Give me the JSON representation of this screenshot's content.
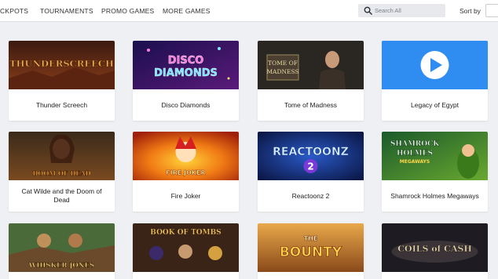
{
  "nav": {
    "items": [
      "CKPOTS",
      "TOURNAMENTS",
      "PROMO GAMES",
      "MORE GAMES"
    ]
  },
  "search": {
    "placeholder": "Search All",
    "icon": "search-icon"
  },
  "sort": {
    "label": "Sort by"
  },
  "games": [
    {
      "title": "Thunder Screech",
      "art_text": "THUNDERSCREECH"
    },
    {
      "title": "Disco Diamonds",
      "art_text_1": "DISCO",
      "art_text_2": "DIAMONDS"
    },
    {
      "title": "Tome of Madness",
      "art_text_1": "TOME OF",
      "art_text_2": "MADNESS"
    },
    {
      "title": "Legacy of Egypt",
      "icon": "play-icon"
    },
    {
      "title": "Cat Wilde and the Doom of Dead",
      "art_text": "DOOM OF DEAD"
    },
    {
      "title": "Fire Joker",
      "art_text": "FIRE JOKER"
    },
    {
      "title": "Reactoonz 2",
      "art_text": "REACTOONZ"
    },
    {
      "title": "Shamrock Holmes Megaways",
      "art_text_1": "SHAMROCK",
      "art_text_2": "HOLMES",
      "art_text_3": "MEGAWAYS"
    },
    {
      "title": "",
      "art_text": "WHISKER JONES"
    },
    {
      "title": "",
      "art_text": "BOOK OF TOMBS"
    },
    {
      "title": "",
      "art_text_1": "THE",
      "art_text_2": "BOUNTY"
    },
    {
      "title": "",
      "art_text": "COILS of CASH"
    }
  ],
  "colors": {
    "page_bg": "#eef0f3",
    "accent_blue": "#2f8cf0"
  }
}
